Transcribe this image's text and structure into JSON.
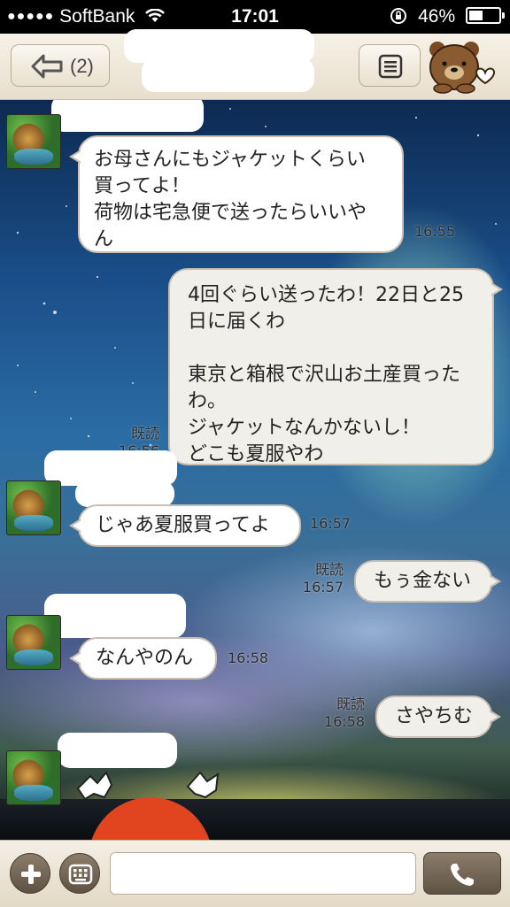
{
  "status_bar": {
    "carrier": "SoftBank",
    "signal": "●●●●●",
    "time": "17:01",
    "battery": "46%",
    "battery_level": 0.46
  },
  "nav": {
    "back_count": "(2)"
  },
  "messages": [
    {
      "side": "left",
      "text": "お母さんにもジャケットくらい\n買ってよ！\n荷物は宅急便で送ったらいいや\nん",
      "time": "16:55"
    },
    {
      "side": "right",
      "text": "4回ぐらい送ったわ！22日と25\n日に届くわ\n\n東京と箱根で沢山お土産買った\nわ。\nジャケットなんかないし！\nどこも夏服やわ",
      "read": "既読",
      "time": "16:56"
    },
    {
      "side": "left",
      "text": "じゃあ夏服買ってよ",
      "time": "16:57"
    },
    {
      "side": "right",
      "text": "もぅ金ない",
      "read": "既読",
      "time": "16:57"
    },
    {
      "side": "left",
      "text": "なんやのん",
      "time": "16:58"
    },
    {
      "side": "right",
      "text": "さやちむ",
      "read": "既読",
      "time": "16:58"
    }
  ],
  "input": {
    "value": "",
    "placeholder": ""
  },
  "icons": {
    "back": "back-arrow-icon",
    "menu": "menu-icon",
    "plus": "plus-icon",
    "keyboard": "keyboard-icon",
    "call": "phone-icon"
  },
  "colors": {
    "bar": "#e8dfcd",
    "bubble_border": "#c8bfb2",
    "button": "#6f6153"
  }
}
